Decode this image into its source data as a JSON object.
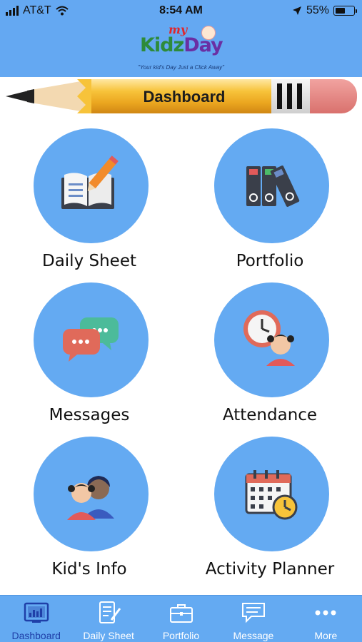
{
  "status": {
    "carrier": "AT&T",
    "time": "8:54 AM",
    "battery_percent": "55%",
    "battery_level": 0.55
  },
  "header": {
    "logo_my": "my",
    "logo_kidz": "Kidz",
    "logo_day": "Day",
    "tagline": "\"Your kid's Day Just a Click Away\""
  },
  "banner": {
    "title": "Dashboard"
  },
  "tiles": [
    {
      "label": "Daily Sheet",
      "icon": "open-book-pencil-icon"
    },
    {
      "label": "Portfolio",
      "icon": "binders-icon"
    },
    {
      "label": "Messages",
      "icon": "chat-bubbles-icon"
    },
    {
      "label": "Attendance",
      "icon": "clock-child-icon"
    },
    {
      "label": "Kid's Info",
      "icon": "kids-avatars-icon"
    },
    {
      "label": "Activity Planner",
      "icon": "calendar-clock-icon"
    }
  ],
  "tabbar": {
    "active": "Dashboard",
    "items": [
      {
        "label": "Dashboard",
        "icon": "dashboard-icon"
      },
      {
        "label": "Daily Sheet",
        "icon": "daily-sheet-icon"
      },
      {
        "label": "Portfolio",
        "icon": "briefcase-icon"
      },
      {
        "label": "Message",
        "icon": "message-icon"
      },
      {
        "label": "More",
        "icon": "more-dots-icon"
      }
    ]
  },
  "colors": {
    "header_blue": "#64a8f2",
    "tile_blue": "#64aaf2",
    "active_tab": "#1f3fa8"
  }
}
